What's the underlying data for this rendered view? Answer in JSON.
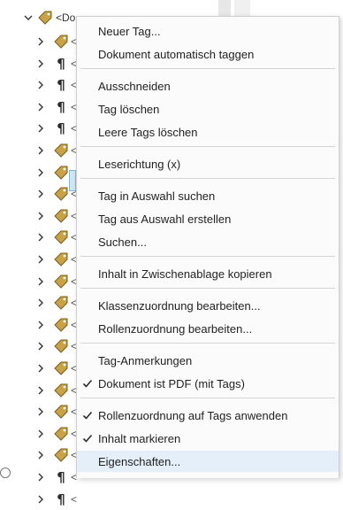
{
  "tree": {
    "root_label": "<Do",
    "rows": [
      {
        "kind": "tag"
      },
      {
        "kind": "para"
      },
      {
        "kind": "para"
      },
      {
        "kind": "para"
      },
      {
        "kind": "para"
      },
      {
        "kind": "tag"
      },
      {
        "kind": "tag"
      },
      {
        "kind": "tag"
      },
      {
        "kind": "tag"
      },
      {
        "kind": "tag"
      },
      {
        "kind": "tag"
      },
      {
        "kind": "tag"
      },
      {
        "kind": "tag"
      },
      {
        "kind": "tag"
      },
      {
        "kind": "tag"
      },
      {
        "kind": "tag"
      },
      {
        "kind": "tag"
      },
      {
        "kind": "tag"
      },
      {
        "kind": "tag"
      },
      {
        "kind": "tag"
      },
      {
        "kind": "para"
      },
      {
        "kind": "para"
      }
    ],
    "lt": "<"
  },
  "menu": {
    "items": [
      {
        "label": "Neuer Tag...",
        "checked": false
      },
      {
        "label": "Dokument automatisch taggen",
        "checked": false
      },
      {
        "label": "Ausschneiden",
        "checked": false
      },
      {
        "label": "Tag löschen",
        "checked": false
      },
      {
        "label": "Leere Tags löschen",
        "checked": false
      },
      {
        "label": "Leserichtung (x)",
        "checked": false
      },
      {
        "label": "Tag in Auswahl suchen",
        "checked": false
      },
      {
        "label": "Tag aus Auswahl erstellen",
        "checked": false
      },
      {
        "label": "Suchen...",
        "checked": false
      },
      {
        "label": "Inhalt in Zwischenablage kopieren",
        "checked": false
      },
      {
        "label": "Klassenzuordnung bearbeiten...",
        "checked": false
      },
      {
        "label": "Rollenzuordnung bearbeiten...",
        "checked": false
      },
      {
        "label": "Tag-Anmerkungen",
        "checked": false
      },
      {
        "label": "Dokument ist PDF (mit Tags)",
        "checked": true
      },
      {
        "label": "Rollenzuordnung auf Tags anwenden",
        "checked": true
      },
      {
        "label": "Inhalt markieren",
        "checked": true
      },
      {
        "label": "Eigenschaften...",
        "checked": false,
        "hovered": true
      }
    ],
    "check_color": "#2b2b2b",
    "hover_color": "#e5eff9"
  }
}
